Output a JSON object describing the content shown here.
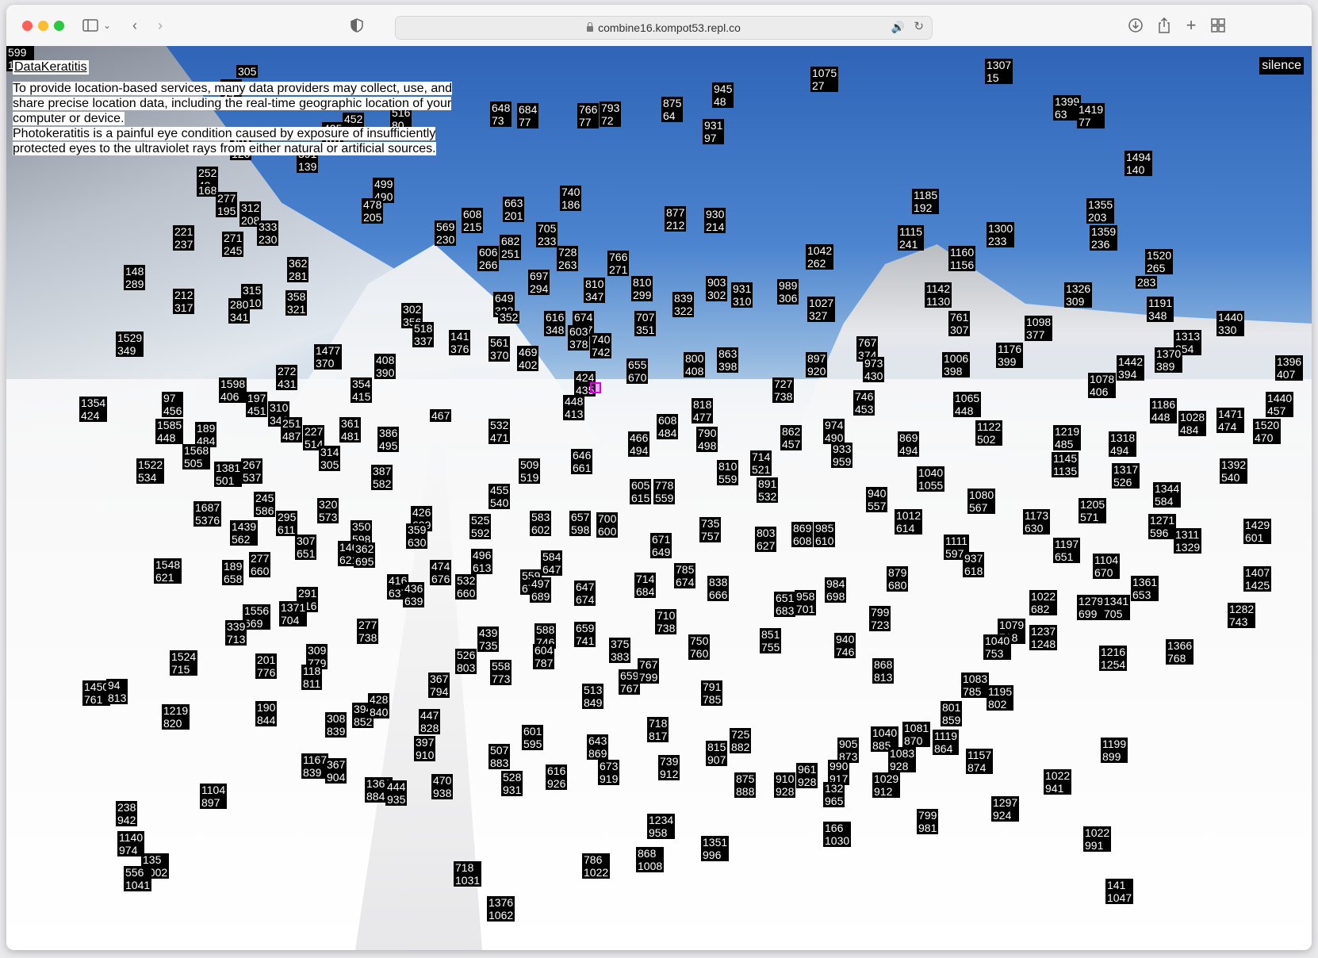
{
  "browser": {
    "url": "combine16.kompot53.repl.co",
    "icons": [
      "sidebar-icon",
      "chevron-down-icon",
      "back-icon",
      "forward-icon",
      "shield-icon",
      "lock-icon",
      "speaker-icon",
      "reload-icon",
      "download-icon",
      "share-icon",
      "plus-icon",
      "tab-overview-icon"
    ]
  },
  "page": {
    "title": "DataKeratitis",
    "lines": [
      "To provide location-based services, many data providers may collect, use, and",
      "share precise location data, including the real-time geographic location of your",
      "computer or device.",
      "Photokeratitis is a painful eye condition caused by exposure of insufficiently",
      "protected eyes to the ultraviolet rays from either natural or artificial sources."
    ],
    "silence_label": "silence"
  },
  "labels": [
    "305",
    "1075\n27",
    "1307\n15",
    "287\n47",
    "516\n80",
    "945\n48",
    "648\n73",
    "684\n77",
    "766\n77",
    "793\n72",
    "875\n64",
    "1399\n63",
    "1419\n77",
    "931\n97",
    "452\n93",
    "425\n101",
    "303\n120",
    "391\n139",
    "1494\n140",
    "252\n49",
    "168",
    "277\n195",
    "499\n490",
    "478\n205",
    "740\n186",
    "663\n201",
    "1185\n192",
    "312\n208",
    "333\n230",
    "569\n230",
    "608\n215",
    "705\n233",
    "877\n212",
    "930\n214",
    "1355\n203",
    "221\n237",
    "271\n245",
    "682\n251",
    "1300\n233",
    "1359\n236",
    "606\n266",
    "728\n263",
    "1042\n262",
    "1115\n241",
    "1160\n1156",
    "362\n281",
    "148\n289",
    "766\n271",
    "697\n294",
    "810\n299",
    "903\n302",
    "931\n310",
    "989\n306",
    "212\n317",
    "315\n310",
    "358\n321",
    "649\n322",
    "839\n322",
    "1027\n327",
    "1142\n1130",
    "1326\n309",
    "1520\n265",
    "283",
    "280\n341",
    "302\n356",
    "518\n337",
    "352",
    "616\n348",
    "674\n347",
    "707\n351",
    "810\n347",
    "761\n307",
    "1191\n348",
    "1440\n330",
    "1529\n349",
    "141\n376",
    "561\n370",
    "603\n378",
    "740\n742",
    "767\n374",
    "1098\n377",
    "1313\n354",
    "1477\n370",
    "408\n390",
    "469\n402",
    "655\n670",
    "800\n408",
    "863\n398",
    "897\n920",
    "1006\n398",
    "1176\n399",
    "1370\n389",
    "1442\n394",
    "1396\n407",
    "1598\n406",
    "272\n431",
    "354\n415",
    "424\n435",
    "727\n738",
    "973\n430",
    "1078\n406",
    "1354\n424",
    "97\n456",
    "197\n451",
    "310\n346",
    "448\n413",
    "746\n453",
    "1065\n448",
    "1186\n448",
    "1440\n457",
    "1585\n448",
    "189\n484",
    "251\n487",
    "361\n481",
    "467",
    "532\n471",
    "608\n484",
    "818\n477",
    "862\n457",
    "974\n490",
    "1028\n484",
    "1471\n474",
    "1520\n470",
    "1568\n505",
    "227\n514",
    "386\n495",
    "466\n494",
    "790\n498",
    "869\n494",
    "1122\n502",
    "1219\n485",
    "1318\n494",
    "1381\n501",
    "267\n537",
    "314\n305",
    "509\n519",
    "646\n661",
    "714\n521",
    "933\n959",
    "1040\n1055",
    "1145\n1135",
    "1317\n526",
    "1392\n540",
    "1522\n534",
    "1687\n5376",
    "245\n586",
    "320\n573",
    "387\n582",
    "455\n540",
    "605\n615",
    "778\n559",
    "810\n559",
    "891\n532",
    "940\n557",
    "1080\n567",
    "1205\n571",
    "1344\n584",
    "1439\n562",
    "295\n611",
    "350\n598",
    "426\n609",
    "525\n592",
    "583\n602",
    "657\n598",
    "700\n600",
    "735\n757",
    "869\n608",
    "985\n610",
    "1012\n614",
    "1111\n597",
    "1173\n630",
    "1271\n596",
    "1429\n601",
    "1548\n621",
    "189\n658",
    "277\n660",
    "307\n651",
    "359\n630",
    "496\n613",
    "584\n647",
    "671\n649",
    "803\n627",
    "937\n618",
    "1197\n651",
    "1311\n1329",
    "1461\n621",
    "416\n637",
    "474\n676",
    "532\n660",
    "559\n679",
    "647\n674",
    "714\n684",
    "785\n674",
    "838\n666",
    "879\n680",
    "1104\n670",
    "1361\n653",
    "1407\n1425",
    "1556\n669",
    "291\n716",
    "362\n695",
    "436\n639",
    "497\n689",
    "651\n683",
    "958\n701",
    "984\n698",
    "1022\n682",
    "1279\n699",
    "1341\n705",
    "1371\n704",
    "339\n713",
    "277\n738",
    "439\n735",
    "588\n746",
    "659\n741",
    "710\n738",
    "799\n723",
    "1079\n718",
    "1237\n1248",
    "1282\n743",
    "1524\n715",
    "201\n776",
    "309\n779",
    "375\n383",
    "750\n760",
    "851\n755",
    "940\n746",
    "1040\n753",
    "1216\n1254",
    "1366\n768",
    "1450\n761",
    "94\n813",
    "118\n811",
    "367\n794",
    "526\n803",
    "558\n773",
    "604\n787",
    "659\n767",
    "767\n799",
    "791\n785",
    "868\n813",
    "1083\n785",
    "1195\n802",
    "1219\n820",
    "190\n844",
    "308\n839",
    "394\n852",
    "428\n840",
    "447\n828",
    "513\n849",
    "718\n817",
    "801\n859",
    "1167\n839",
    "367\n904",
    "397\n910",
    "507\n883",
    "601\n595",
    "643\n869",
    "725\n882",
    "905\n873",
    "1040\n885",
    "1081\n870",
    "1119\n864",
    "1157\n874",
    "1199\n899",
    "1369\n884",
    "444\n935",
    "470\n938",
    "528\n931",
    "616\n926",
    "673\n919",
    "739\n912",
    "815\n907",
    "875\n888",
    "910\n928",
    "961\n928",
    "990\n917",
    "1029\n912",
    "1083\n928",
    "1104\n897",
    "238\n942",
    "132\n965",
    "1022\n941",
    "1297\n924",
    "1234\n958",
    "799\n981",
    "1140\n974",
    "135\n1002",
    "166\n1030",
    "1022\n991",
    "1351\n996",
    "868\n1008",
    "786\n1022",
    "718\n1031",
    "556\n1041",
    "141\n1047",
    "1376\n1062",
    "599\n1084"
  ]
}
